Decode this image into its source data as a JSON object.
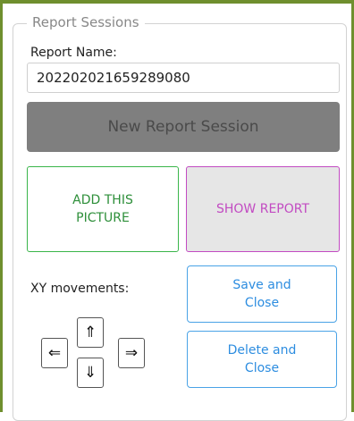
{
  "session": {
    "legend": "Report Sessions",
    "report_name_label": "Report Name:",
    "report_name_value": "202202021659289080",
    "new_session_label": "New Report Session"
  },
  "actions": {
    "add_picture_label": "ADD THIS PICTURE",
    "show_report_label": "SHOW REPORT"
  },
  "movement": {
    "label": "XY movements:",
    "left_glyph": "⇐",
    "up_glyph": "⇑",
    "down_glyph": "⇓",
    "right_glyph": "⇒"
  },
  "closing": {
    "save_label": "Save and Close",
    "delete_label": "Delete and Close"
  },
  "colors": {
    "frame": "#6f8f2e",
    "add_border": "#3ab54a",
    "show_border": "#c24bc2",
    "blue_border": "#4aa3e6",
    "new_session_bg": "#7f7f7f"
  }
}
